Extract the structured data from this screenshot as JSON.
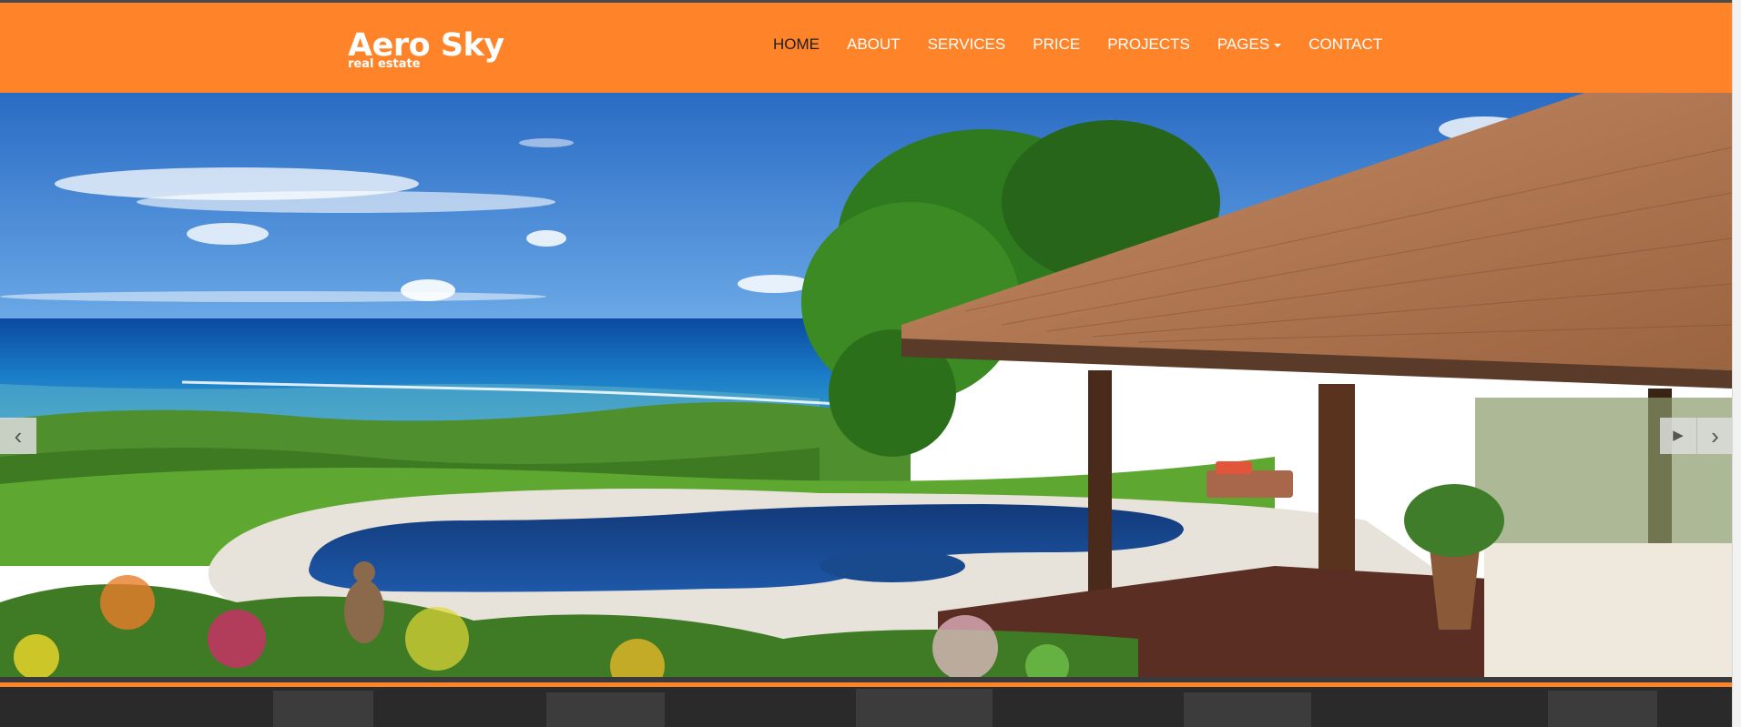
{
  "brand": {
    "name": "Aero Sky",
    "tagline": "real estate",
    "accent_color": "#ff8429"
  },
  "nav": {
    "items": [
      {
        "label": "HOME",
        "active": true
      },
      {
        "label": "ABOUT"
      },
      {
        "label": "SERVICES"
      },
      {
        "label": "PRICE"
      },
      {
        "label": "PROJECTS"
      },
      {
        "label": "PAGES",
        "dropdown": true
      },
      {
        "label": "CONTACT"
      }
    ]
  },
  "slider": {
    "prev_icon": "‹",
    "play_icon": "▶",
    "next_icon": "›"
  }
}
